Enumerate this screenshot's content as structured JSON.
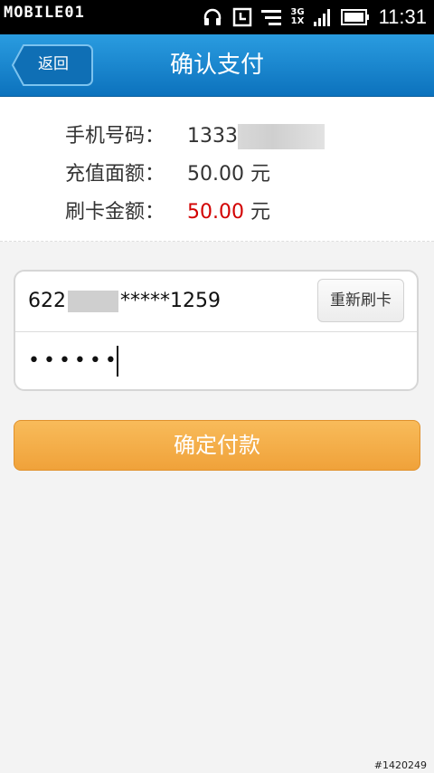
{
  "status_bar": {
    "logo": "MOBILE01",
    "network": "3G\n1X",
    "time": "11:31"
  },
  "header": {
    "back_label": "返回",
    "title": "确认支付"
  },
  "info": {
    "phone_label": "手机号码：",
    "phone_value": "1333",
    "recharge_label": "充值面额：",
    "recharge_value": "50.00 元",
    "swipe_label": "刷卡金额：",
    "swipe_amount": "50.00",
    "swipe_unit": " 元"
  },
  "card": {
    "number_prefix": "622",
    "number_suffix": "*****1259",
    "reswipe_label": "重新刷卡",
    "password_mask": "••••••"
  },
  "actions": {
    "confirm_label": "确定付款"
  },
  "watermark": "#1420249",
  "colors": {
    "header_blue": "#1a86d0",
    "confirm_orange": "#f3ac47",
    "amount_red": "#d20000"
  }
}
